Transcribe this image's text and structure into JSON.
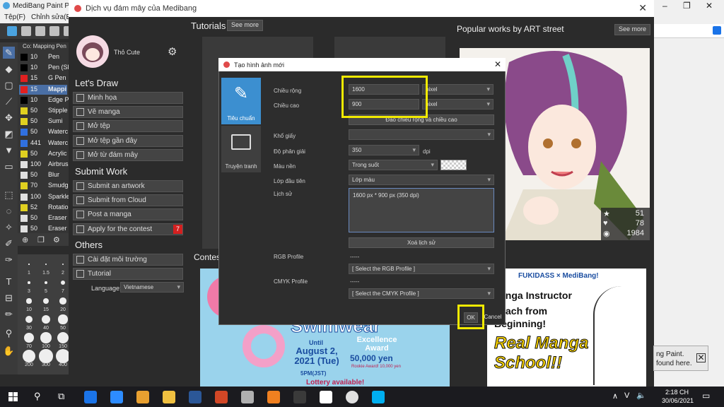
{
  "app": {
    "title": "MediBang Paint Pro",
    "menu": [
      "Tệp(F)",
      "Chỉnh sửa(E)"
    ]
  },
  "brush_panel": {
    "header": "Co: Mapping Pen",
    "brushes": [
      {
        "size": "10",
        "name": "Pen",
        "color": "#000000"
      },
      {
        "size": "10",
        "name": "Pen (Sh",
        "color": "#000000"
      },
      {
        "size": "15",
        "name": "G Pen",
        "color": "#e02020"
      },
      {
        "size": "15",
        "name": "Mappi",
        "color": "#e02020",
        "selected": true
      },
      {
        "size": "10",
        "name": "Edge P",
        "color": "#000000"
      },
      {
        "size": "50",
        "name": "Stipple",
        "color": "#e0d020"
      },
      {
        "size": "50",
        "name": "Sumi",
        "color": "#e0d020"
      },
      {
        "size": "50",
        "name": "Waterc",
        "color": "#3070e0"
      },
      {
        "size": "441",
        "name": "Waterc",
        "color": "#3070e0"
      },
      {
        "size": "50",
        "name": "Acrylic",
        "color": "#e0d020"
      },
      {
        "size": "100",
        "name": "Airbrus",
        "color": "#e0e0e0"
      },
      {
        "size": "50",
        "name": "Blur",
        "color": "#e0e0e0"
      },
      {
        "size": "70",
        "name": "Smudgi",
        "color": "#e0d020"
      },
      {
        "size": "100",
        "name": "Sparkle",
        "color": "#e0e0e0"
      },
      {
        "size": "52",
        "name": "Rotation",
        "color": "#e0d020"
      },
      {
        "size": "50",
        "name": "Eraser (",
        "color": "#e0e0e0"
      },
      {
        "size": "50",
        "name": "Eraser",
        "color": "#e0e0e0"
      }
    ],
    "sizes": [
      "1",
      "1.5",
      "2",
      "3",
      "5",
      "7",
      "10",
      "15",
      "20",
      "30",
      "40",
      "50",
      "70",
      "100",
      "150",
      "200",
      "300",
      "400"
    ]
  },
  "cloud_window": {
    "title": "Dịch vụ đám mây của Medibang",
    "username": "Thỏ Cute",
    "lets_draw": {
      "heading": "Let's Draw",
      "items": [
        "Minh họa",
        "Vẽ manga",
        "Mở tệp",
        "Mở tệp gần đây",
        "Mở từ đám mây"
      ]
    },
    "submit_work": {
      "heading": "Submit Work",
      "items": [
        "Submit an artwork",
        "Submit from Cloud",
        "Post a manga",
        "Apply for the contest"
      ],
      "contest_badge": "7"
    },
    "others": {
      "heading": "Others",
      "items": [
        "Cài đặt môi trường",
        "Tutorial"
      ],
      "language_label": "Language:",
      "language_value": "Vietnamese"
    },
    "tutorials": {
      "heading": "Tutorials",
      "see_more": "See more"
    },
    "popular": {
      "heading": "Popular works by ART street",
      "see_more": "See more",
      "stats": {
        "stars": "51",
        "hearts": "78",
        "views": "1984"
      }
    },
    "contest_heading": "Contes",
    "banner_left": {
      "brand": "Swimwear",
      "until": "Until",
      "date": "August 2, 2021 (Tue)",
      "time": "5PM(JST)",
      "award": "Excellence Award",
      "prize": "50,000 yen",
      "rookie": "Rookie Award! 10,000 yen",
      "lottery": "Lottery available!"
    },
    "banner_right": {
      "brands": "FUKIDASS × MediBang!",
      "line1": "anga Instructor",
      "line2": "ach from",
      "line3": "Beginning!",
      "line4": "Real Manga",
      "line5": "School!!"
    }
  },
  "dialog": {
    "title": "Tạo hình ảnh mới",
    "tabs": [
      {
        "label": "Tiêu chuẩn",
        "icon": "brush-icon",
        "active": true
      },
      {
        "label": "Truyện tranh",
        "icon": "book-icon",
        "active": false
      }
    ],
    "width_label": "Chiều rộng",
    "width_value": "1600",
    "width_unit": "pixel",
    "height_label": "Chiều cao",
    "height_value": "900",
    "height_unit": "pixel",
    "swap_button": "Đảo chiều rộng và chiều cao",
    "paper_label": "Khổ giấy",
    "paper_value": "",
    "resolution_label": "Độ phân giải",
    "resolution_value": "350",
    "resolution_unit": "dpi",
    "background_label": "Màu nền",
    "background_value": "Trong suốt",
    "first_layer_label": "Lớp đầu tiên",
    "first_layer_value": "Lớp màu",
    "history_label": "Lịch sử",
    "history_entry": "1600 px * 900 px (350 dpi)",
    "clear_history_button": "Xoá lịch sử",
    "rgb_label": "RGB Profile",
    "rgb_value": "-----",
    "rgb_select": "[ Select the RGB Profile ]",
    "cmyk_label": "CMYK Profile",
    "cmyk_value": "-----",
    "cmyk_select": "[ Select the CMYK Profile ]",
    "ok": "OK",
    "cancel": "Cancel"
  },
  "notification": {
    "line1": "ng Paint.",
    "line2": "found here."
  },
  "taskbar": {
    "time": "2:18 CH",
    "date": "30/06/2021",
    "lang": "V",
    "apps": [
      "zalo",
      "zoom",
      "snip",
      "explorer",
      "word",
      "powerpoint",
      "paint",
      "files",
      "medibang",
      "medibang",
      "chrome",
      "skype"
    ]
  }
}
